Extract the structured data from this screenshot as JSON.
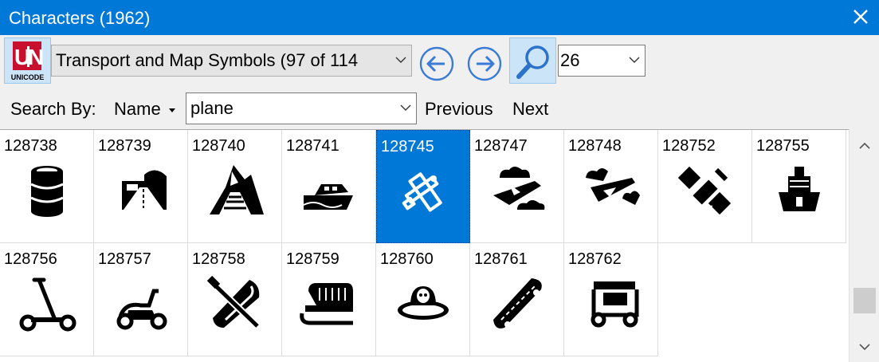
{
  "window": {
    "title": "Characters (1962)"
  },
  "toolbar": {
    "logo_text": "UNICODE",
    "block_value": "Transport and Map Symbols (97 of 114",
    "size_value": "26",
    "search_by_label": "Search By:",
    "search_mode": "Name",
    "search_value": "plane",
    "previous_label": "Previous",
    "next_label": "Next"
  },
  "grid": {
    "cells": [
      {
        "code": "128738",
        "icon": "oil-drum-icon"
      },
      {
        "code": "128739",
        "icon": "motorway-icon"
      },
      {
        "code": "128740",
        "icon": "mountain-railway-icon"
      },
      {
        "code": "128741",
        "icon": "motor-boat-icon"
      },
      {
        "code": "128745",
        "icon": "small-airplane-icon",
        "selected": true
      },
      {
        "code": "128747",
        "icon": "airplane-clouds-icon"
      },
      {
        "code": "128748",
        "icon": "airplane-departure-icon"
      },
      {
        "code": "128752",
        "icon": "satellite-icon"
      },
      {
        "code": "128755",
        "icon": "passenger-ship-icon"
      },
      {
        "code": "128756",
        "icon": "kick-scooter-icon"
      },
      {
        "code": "128757",
        "icon": "motor-scooter-icon"
      },
      {
        "code": "128758",
        "icon": "canoe-icon"
      },
      {
        "code": "128759",
        "icon": "sled-icon"
      },
      {
        "code": "128760",
        "icon": "flying-saucer-icon"
      },
      {
        "code": "128761",
        "icon": "skateboard-icon"
      },
      {
        "code": "128762",
        "icon": "auto-rickshaw-icon"
      }
    ]
  },
  "colors": {
    "accent": "#0078d7",
    "selection": "#0078d7",
    "nav_arrow": "#3a7bd5"
  }
}
